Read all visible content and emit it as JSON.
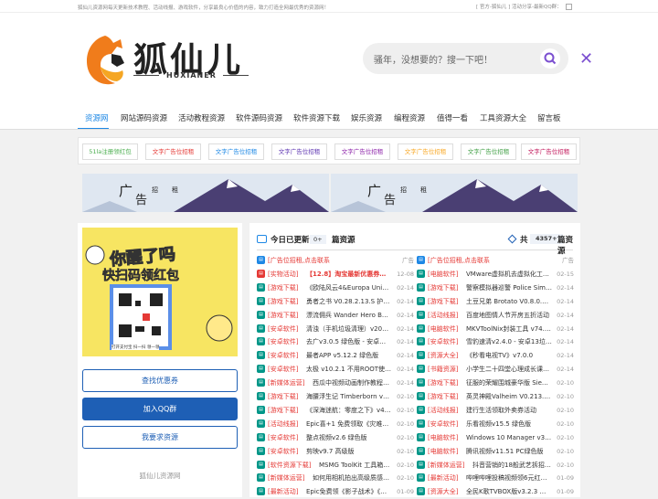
{
  "topbar": {
    "left_text": "狐仙儿资源网每天更新技术教程、活动线报、游戏软件，分享最良心价值的内容，致力打造全网最优秀的资源网！",
    "right_text": "[ 官方-狐仙儿 ] 活动分享-最新QQ群："
  },
  "logo": {
    "cn": "狐仙儿",
    "en": "HUXIANER"
  },
  "search": {
    "placeholder": "骚年，没想要的？搜一下吧！",
    "close": "✕"
  },
  "nav": [
    "资源网",
    "网站源码资源",
    "活动教程资源",
    "软件源码资源",
    "软件资源下载",
    "娱乐资源",
    "编程资源",
    "值得一看",
    "工具资源大全",
    "留言板"
  ],
  "ads": [
    "51la注册领红包",
    "文字广告位招租",
    "文字广告位招租",
    "文字广告位招租",
    "文字广告位招租",
    "文字广告位招租",
    "文字广告位招租",
    "文字广告位招租"
  ],
  "ad_colors": [
    "#4caf50",
    "#e53935",
    "#1e88e5",
    "#5e35b1",
    "#8e24aa",
    "#f9a825",
    "#43a047",
    "#c2185b"
  ],
  "banner": {
    "t1": "广",
    "t2": "招",
    "t3": "租",
    "t4": "告"
  },
  "sidebar": {
    "poster_line1": "你醒了吗",
    "poster_line2": "快扫码领红包",
    "poster_sub": "打开支付宝 扫一扫 领一领",
    "buttons": [
      "查找优惠券",
      "加入QQ群",
      "我要求资源"
    ],
    "footer": "狐仙儿资源网"
  },
  "main": {
    "title": "今日已更新",
    "count_today": "0+",
    "suffix1": "篇资源",
    "total_label": "共",
    "total": "4357+",
    "suffix2": "篇资源"
  },
  "left_col": [
    {
      "tag": "[广告位招租,点击联系",
      "title": "",
      "date": "广告",
      "tc": "#e53935",
      "ic": "#1e88e5"
    },
    {
      "tag": "[实物活动]",
      "title": "【12.8】淘宝最新优惠券、每…",
      "date": "12-08",
      "tc": "#e53935",
      "ic": "#e53935",
      "bold": true,
      "titlecolor": "#e53935"
    },
    {
      "tag": "[游戏下载]",
      "title": "《欧陆风云4&Europa Univer…",
      "date": "02-14",
      "tc": "#e53935",
      "ic": "#009688"
    },
    {
      "tag": "[游戏下载]",
      "title": "勇者之书 V0.28.2.13.S 护盾…",
      "date": "02-14",
      "tc": "#e53935",
      "ic": "#009688"
    },
    {
      "tag": "[游戏下载]",
      "title": "漂流佣兵 Wander Hero Build…",
      "date": "02-14",
      "tc": "#e53935",
      "ic": "#009688"
    },
    {
      "tag": "[安卓软件]",
      "title": "清浊（手机垃圾清理）v202…",
      "date": "02-14",
      "tc": "#e53935",
      "ic": "#009688"
    },
    {
      "tag": "[安卓软件]",
      "title": "去广v3.0.5 绿色版 - 安卓…",
      "date": "02-14",
      "tc": "#e53935",
      "ic": "#009688"
    },
    {
      "tag": "[安卓软件]",
      "title": "最者APP v5.12.2 绿色版",
      "date": "02-14",
      "tc": "#e53935",
      "ic": "#009688"
    },
    {
      "tag": "[安卓软件]",
      "title": "太极 v10.2.1 不用ROOT使用…",
      "date": "02-14",
      "tc": "#e53935",
      "ic": "#009688"
    },
    {
      "tag": "[新媒体运营]",
      "title": "西瓜中视频动画制作教程…",
      "date": "02-14",
      "tc": "#e53935",
      "ic": "#009688"
    },
    {
      "tag": "[游戏下载]",
      "title": "海腰浮生记 Timberborn v0.3.…",
      "date": "02-10",
      "tc": "#e53935",
      "ic": "#009688"
    },
    {
      "tag": "[游戏下载]",
      "title": "《深海迷航：零度之下》v49…",
      "date": "02-10",
      "tc": "#e53935",
      "ic": "#009688"
    },
    {
      "tag": "[活动线报]",
      "title": "Epic喜+1 免费领取《灾难菜…",
      "date": "02-10",
      "tc": "#e53935",
      "ic": "#009688"
    },
    {
      "tag": "[安卓软件]",
      "title": "整点视频v2.6 绿色版",
      "date": "02-10",
      "tc": "#e53935",
      "ic": "#009688"
    },
    {
      "tag": "[安卓软件]",
      "title": "剪映v9.7 高级版",
      "date": "02-10",
      "tc": "#e53935",
      "ic": "#009688"
    },
    {
      "tag": "[软件资源下载]",
      "title": "MSMG ToolKit 工具箱v1…",
      "date": "02-10",
      "tc": "#e53935",
      "ic": "#009688"
    },
    {
      "tag": "[新媒体运营]",
      "title": "如何用相机拍出高级质感…",
      "date": "02-10",
      "tc": "#e53935",
      "ic": "#009688"
    },
    {
      "tag": "[最新活动]",
      "title": "Epic免费领《影子战术》《…",
      "date": "01-09",
      "tc": "#e53935",
      "ic": "#009688"
    }
  ],
  "right_col": [
    {
      "tag": "[广告位招租,点击联系",
      "title": "",
      "date": "广告",
      "tc": "#e53935",
      "ic": "#1e88e5"
    },
    {
      "tag": "[电脑软件]",
      "title": "VMware虚拟机去虚拟化工具…",
      "date": "02-15",
      "tc": "#e53935",
      "ic": "#009688"
    },
    {
      "tag": "[游戏下载]",
      "title": "警察模拟器巡警 Police Simul…",
      "date": "02-14",
      "tc": "#e53935",
      "ic": "#009688"
    },
    {
      "tag": "[游戏下载]",
      "title": "土豆兄弟 Brotato V0.8.0.3 无…",
      "date": "02-14",
      "tc": "#e53935",
      "ic": "#009688"
    },
    {
      "tag": "[活动线报]",
      "title": "百度地图情人节开房五折活动",
      "date": "02-14",
      "tc": "#e53935",
      "ic": "#009688"
    },
    {
      "tag": "[电脑软件]",
      "title": "MKVToolNix封装工具 v74.0 …",
      "date": "02-14",
      "tc": "#e53935",
      "ic": "#009688"
    },
    {
      "tag": "[安卓软件]",
      "title": "雪豹速清v2.4.0 - 安卓13垃圾…",
      "date": "02-14",
      "tc": "#e53935",
      "ic": "#009688"
    },
    {
      "tag": "[资源大全]",
      "title": "《秒看电视TV》v7.0.0",
      "date": "02-14",
      "tc": "#e53935",
      "ic": "#009688"
    },
    {
      "tag": "[书籍资源]",
      "title": "小学生二十四堂心理成长课…",
      "date": "02-14",
      "tc": "#e53935",
      "ic": "#009688"
    },
    {
      "tag": "[游戏下载]",
      "title": "征服的荣耀围城豪华版 Siege…",
      "date": "02-10",
      "tc": "#e53935",
      "ic": "#009688"
    },
    {
      "tag": "[游戏下载]",
      "title": "英灵神殿Valheim V0.213.4 P…",
      "date": "02-10",
      "tc": "#e53935",
      "ic": "#009688"
    },
    {
      "tag": "[活动线报]",
      "title": "建行生活领取外卖券活动",
      "date": "02-10",
      "tc": "#e53935",
      "ic": "#009688"
    },
    {
      "tag": "[安卓软件]",
      "title": "乐看视频v15.5 绿色版",
      "date": "02-10",
      "tc": "#e53935",
      "ic": "#009688"
    },
    {
      "tag": "[电脑软件]",
      "title": "Windows 10 Manager v3.7.6…",
      "date": "02-10",
      "tc": "#e53935",
      "ic": "#009688"
    },
    {
      "tag": "[电脑软件]",
      "title": "腾讯视频v11.51 PC绿色版",
      "date": "02-10",
      "tc": "#e53935",
      "ic": "#009688"
    },
    {
      "tag": "[新媒体运营]",
      "title": "抖音营销的18般武艺拆招…",
      "date": "02-10",
      "tc": "#e53935",
      "ic": "#009688"
    },
    {
      "tag": "[最新活动]",
      "title": "哔哩哔哩投稿视频领6元红包…",
      "date": "01-09",
      "tc": "#e53935",
      "ic": "#009688"
    },
    {
      "tag": "[资源大全]",
      "title": "全民K歌TVBOX版v3.2.3 免费…",
      "date": "01-09",
      "tc": "#e53935",
      "ic": "#009688"
    }
  ]
}
